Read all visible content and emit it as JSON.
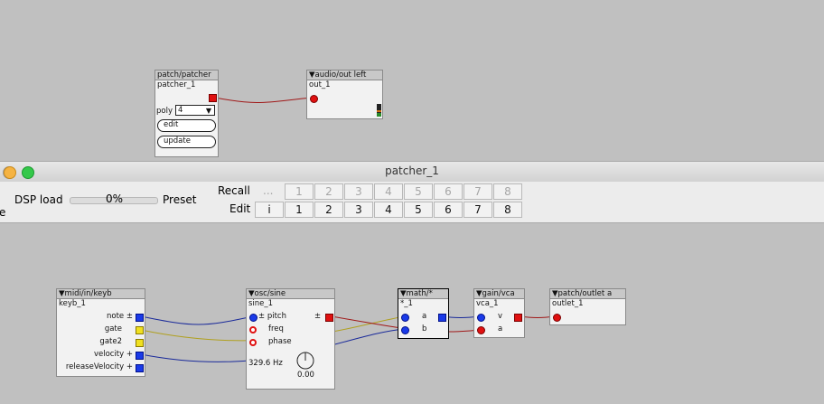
{
  "top_patch": {
    "patcher": {
      "header": "patch/patcher",
      "instance": "patcher_1",
      "poly_label": "poly",
      "poly_value": "4",
      "edit_label": "edit",
      "update_label": "update"
    },
    "audio_out": {
      "header": "▼audio/out left",
      "instance": "out_1"
    }
  },
  "window": {
    "title": "patcher_1",
    "close_color": "#c8c8c8",
    "minimize_color": "#f5b342",
    "zoom_color": "#34c84a"
  },
  "toolbar": {
    "left_clip": "e",
    "dsp_label": "DSP load",
    "dsp_value": "0%",
    "preset_label": "Preset",
    "recall_label": "Recall",
    "edit_label": "Edit",
    "recall_ellipsis": "...",
    "recall_cells": [
      "1",
      "2",
      "3",
      "4",
      "5",
      "6",
      "7",
      "8"
    ],
    "edit_i": "i",
    "edit_cells": [
      "1",
      "2",
      "3",
      "4",
      "5",
      "6",
      "7",
      "8"
    ]
  },
  "sub_patch": {
    "keyb": {
      "header": "▼midi/in/keyb",
      "instance": "keyb_1",
      "outputs": [
        "note ±",
        "gate",
        "gate2",
        "velocity +",
        "releaseVelocity +"
      ]
    },
    "osc": {
      "header": "▼osc/sine",
      "instance": "sine_1",
      "pitch_label": "± pitch",
      "out_label": "±",
      "freq_label": "freq",
      "phase_label": "phase",
      "freq_readout": "329.6 Hz",
      "knob_value": "0.00"
    },
    "math": {
      "header": "▼math/*",
      "instance": "*_1",
      "in_a": "a",
      "in_b": "b"
    },
    "vca": {
      "header": "▼gain/vca",
      "instance": "vca_1",
      "in_v": "v",
      "in_a": "a"
    },
    "outlet": {
      "header": "▼patch/outlet a",
      "instance": "outlet_1"
    }
  },
  "colors": {
    "wire_red": "#a01818",
    "wire_blue": "#1a2a9a",
    "wire_yellow": "#b0a020"
  }
}
